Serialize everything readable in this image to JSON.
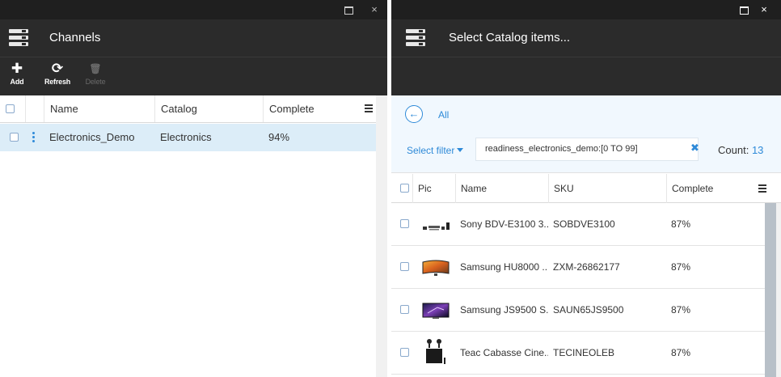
{
  "left": {
    "window_buttons": {
      "maximize": "",
      "close": "×"
    },
    "title": "Channels",
    "toolbar": [
      {
        "icon": "plus-icon",
        "glyph": "✚",
        "label": "Add",
        "enabled": true
      },
      {
        "icon": "refresh-icon",
        "glyph": "⟳",
        "label": "Refresh",
        "enabled": true
      },
      {
        "icon": "trash-icon",
        "glyph": "🗑",
        "label": "Delete",
        "enabled": false
      }
    ],
    "grid": {
      "columns": [
        "Name",
        "Catalog",
        "Complete"
      ],
      "rows": [
        {
          "name": "Electronics_Demo",
          "catalog": "Electronics",
          "complete": "94%"
        }
      ]
    }
  },
  "right": {
    "window_buttons": {
      "maximize": "",
      "close": "×"
    },
    "title": "Select Catalog items...",
    "back_glyph": "←",
    "breadcrumb": "All",
    "select_filter_label": "Select filter",
    "filter_value": "readiness_electronics_demo:[0 TO 99]",
    "filter_clear": "✖",
    "count_label": "Count:",
    "count_value": "13",
    "grid": {
      "columns": [
        "Pic",
        "Name",
        "SKU",
        "Complete"
      ],
      "rows": [
        {
          "name": "Sony BDV-E3100 3...",
          "sku": "SOBDVE3100",
          "complete": "87%",
          "pic": "soundbar-thumbnail"
        },
        {
          "name": "Samsung HU8000 ...",
          "sku": "ZXM-26862177",
          "complete": "87%",
          "pic": "tv-thumbnail"
        },
        {
          "name": "Samsung JS9500 S...",
          "sku": "SAUN65JS9500",
          "complete": "87%",
          "pic": "tv-thumbnail"
        },
        {
          "name": "Teac Cabasse Cine...",
          "sku": "TECINEOLEB",
          "complete": "87%",
          "pic": "speakers-thumbnail"
        }
      ]
    }
  },
  "colors": {
    "accent": "#2e8ad8",
    "header_bg": "#2b2b2b",
    "selected_row": "#dcedf8",
    "filter_bg": "#f1f8fe"
  }
}
